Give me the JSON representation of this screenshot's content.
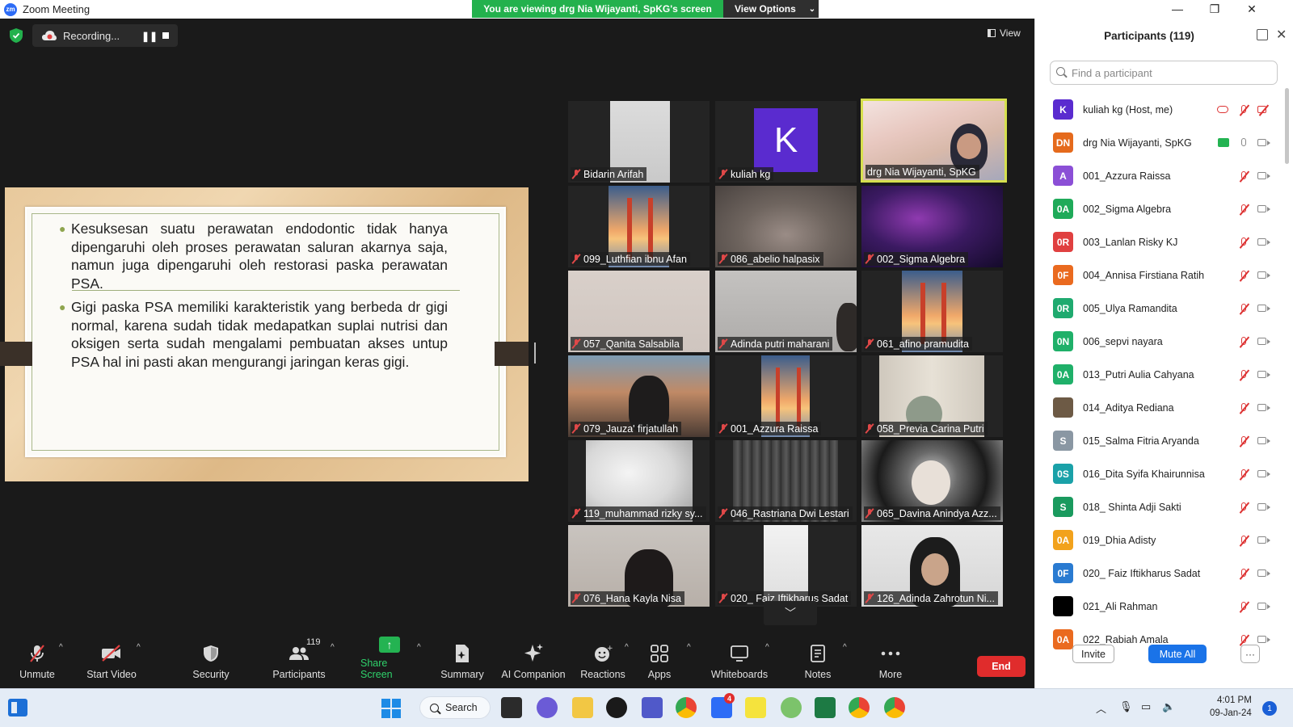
{
  "window": {
    "title": "Zoom Meeting",
    "viewing_banner": "You are viewing drg Nia Wijayanti, SpKG's screen",
    "view_options_label": "View Options",
    "minimize": "—",
    "maximize": "❐",
    "close": "✕"
  },
  "stage": {
    "recording_label": "Recording...",
    "pause_glyph": "❚❚",
    "view_label": "View"
  },
  "slide": {
    "bullets": [
      "Kesuksesan suatu perawatan endodontic tidak hanya dipengaruhi oleh proses perawatan saluran akarnya saja, namun juga dipengaruhi oleh restorasi paska perawatan PSA.",
      "Gigi paska PSA memiliki karakteristik yang berbeda dr gigi normal, karena sudah tidak medapatkan suplai nutrisi dan oksigen serta sudah mengalami pembuatan akses untup PSA hal ini pasti akan mengurangi jaringan keras gigi."
    ]
  },
  "tiles": [
    {
      "name": "Bidarin Arifah"
    },
    {
      "name": "kuliah kg",
      "avatar_letter": "K"
    },
    {
      "name": "drg Nia Wijayanti, SpKG"
    },
    {
      "name": "099_Luthfian ibnu Afan"
    },
    {
      "name": "086_abelio halpasix"
    },
    {
      "name": "002_Sigma Algebra"
    },
    {
      "name": "057_Qanita Salsabila"
    },
    {
      "name": "Adinda putri maharani"
    },
    {
      "name": "061_afino pramudita"
    },
    {
      "name": "079_Jauza' firjatullah"
    },
    {
      "name": "001_Azzura Raissa"
    },
    {
      "name": "058_Previa Carina Putri"
    },
    {
      "name": "119_muhammad rizky sy..."
    },
    {
      "name": "046_Rastriana Dwi Lestari"
    },
    {
      "name": "065_Davina Anindya Azz..."
    },
    {
      "name": "076_Hana Kayla Nisa"
    },
    {
      "name": "020_ Faiz Iftikharus Sadat"
    },
    {
      "name": "126_Adinda Zahrotun Ni..."
    }
  ],
  "toolbar": {
    "unmute": "Unmute",
    "start_video": "Start Video",
    "security": "Security",
    "participants": "Participants",
    "participants_count": "119",
    "share_screen": "Share Screen",
    "summary": "Summary",
    "ai_companion": "AI Companion",
    "reactions": "Reactions",
    "apps": "Apps",
    "whiteboards": "Whiteboards",
    "notes": "Notes",
    "more": "More",
    "end": "End",
    "caret": "^"
  },
  "panel": {
    "title": "Participants (119)",
    "close": "✕",
    "search_placeholder": "Find a participant",
    "participants": [
      {
        "initials": "K",
        "name": "kuliah kg (Host, me)",
        "color": "#5a2bcf"
      },
      {
        "initials": "DN",
        "name": "drg Nia Wijayanti, SpKG",
        "color": "#e56a1c"
      },
      {
        "initials": "A",
        "name": "001_Azzura Raissa",
        "color": "#8b4fd6"
      },
      {
        "initials": "0A",
        "name": "002_Sigma Algebra",
        "color": "#1faa59"
      },
      {
        "initials": "0R",
        "name": "003_Lanlan Risky KJ",
        "color": "#e04040"
      },
      {
        "initials": "0F",
        "name": "004_Annisa Firstiana Ratih",
        "color": "#ea6a1f"
      },
      {
        "initials": "0R",
        "name": "005_Ulya Ramandita",
        "color": "#1faa6f"
      },
      {
        "initials": "0N",
        "name": "006_sepvi nayara",
        "color": "#1fb069"
      },
      {
        "initials": "0A",
        "name": "013_Putri Aulia Cahyana",
        "color": "#1fb069"
      },
      {
        "initials": "",
        "name": "014_Aditya Rediana",
        "color": "#6d5a45"
      },
      {
        "initials": "S",
        "name": "015_Salma Fitria Aryanda",
        "color": "#8a97a3"
      },
      {
        "initials": "0S",
        "name": "016_Dita Syifa Khairunnisa",
        "color": "#1aa1a8"
      },
      {
        "initials": "S",
        "name": "018_ Shinta Adji Sakti",
        "color": "#1a9a5e"
      },
      {
        "initials": "0A",
        "name": "019_Dhia Adisty",
        "color": "#f2a21c"
      },
      {
        "initials": "0F",
        "name": "020_ Faiz Iftikharus Sadat",
        "color": "#2a7bd1"
      },
      {
        "initials": "",
        "name": "021_Ali Rahman",
        "color": "#000000"
      },
      {
        "initials": "0A",
        "name": "022_Rabiah Amala",
        "color": "#ea6a1f"
      }
    ],
    "invite": "Invite",
    "mute_all": "Mute All",
    "more": "···"
  },
  "taskbar": {
    "search_label": "Search",
    "zoom_badge": "4",
    "time": "4:01 PM",
    "date": "09-Jan-24",
    "notification_count": "1"
  }
}
